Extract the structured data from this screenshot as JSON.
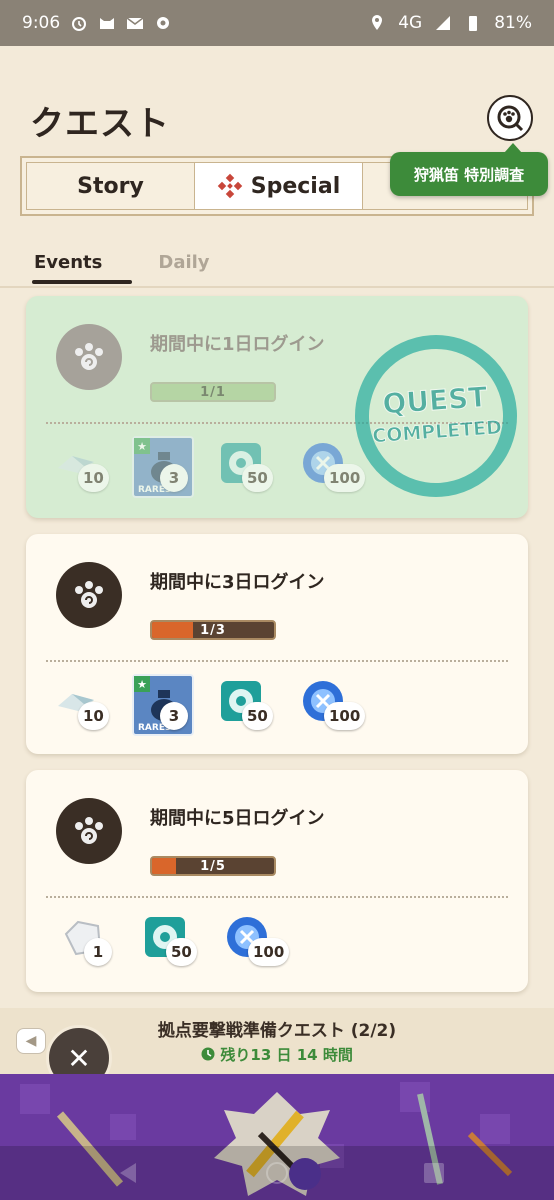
{
  "status_bar": {
    "time": "9:06",
    "network": "4G",
    "battery": "81%",
    "icons": [
      "alarm-icon",
      "cat-app-icon",
      "mail-icon",
      "settings-icon",
      "location-icon",
      "signal-icon",
      "battery-icon"
    ]
  },
  "page": {
    "title": "クエスト",
    "search_icon": "paw-search-icon",
    "tooltip": "狩猟笛 特別調査"
  },
  "segment_tabs": [
    {
      "label": "Story",
      "active": false
    },
    {
      "label": "Special",
      "active": true,
      "icon": "special-diamond-icon"
    }
  ],
  "sub_tabs": [
    {
      "label": "Events",
      "active": true
    },
    {
      "label": "Daily",
      "active": false
    }
  ],
  "quests": [
    {
      "name": "期間中に1日ログイン",
      "progress_text": "1/1",
      "progress": 1.0,
      "completed": true,
      "stamp_text": [
        "QUEST",
        "COMPLETED"
      ],
      "rewards": [
        {
          "item": "armor-sphere-icon",
          "qty": "10"
        },
        {
          "item": "rare-pouch-icon",
          "qty": "3",
          "rarity_label": "RARE3"
        },
        {
          "item": "teal-emblem-icon",
          "qty": "50"
        },
        {
          "item": "blue-orb-icon",
          "qty": "100"
        }
      ]
    },
    {
      "name": "期間中に3日ログイン",
      "progress_text": "1/3",
      "progress": 0.3333,
      "completed": false,
      "rewards": [
        {
          "item": "armor-sphere-icon",
          "qty": "10"
        },
        {
          "item": "rare-pouch-icon",
          "qty": "3",
          "rarity_label": "RARE3"
        },
        {
          "item": "teal-emblem-icon",
          "qty": "50"
        },
        {
          "item": "blue-orb-icon",
          "qty": "100"
        }
      ]
    },
    {
      "name": "期間中に5日ログイン",
      "progress_text": "1/5",
      "progress": 0.2,
      "completed": false,
      "rewards": [
        {
          "item": "white-ore-icon",
          "qty": "1"
        },
        {
          "item": "teal-emblem-icon",
          "qty": "50"
        },
        {
          "item": "blue-orb-icon",
          "qty": "100"
        }
      ]
    }
  ],
  "bottom_bar": {
    "title": "拠点要撃戦準備クエスト (2/2)",
    "time_left": "残り13 日 14 時間",
    "prev_icon": "caret-left-icon",
    "close_icon": "close-icon"
  },
  "colors": {
    "background": "#f3ead9",
    "accent_green": "#3d8b3a",
    "progress_orange": "#d9662b",
    "banner_purple": "#6e3aa3"
  }
}
